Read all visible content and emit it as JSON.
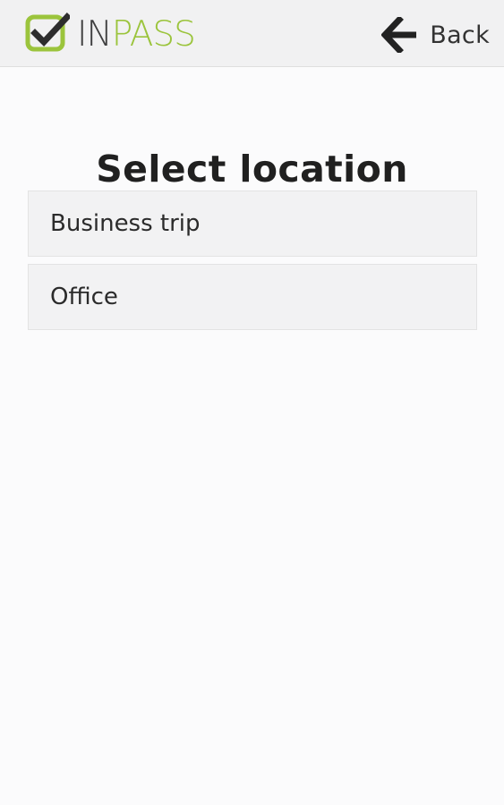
{
  "header": {
    "logo": {
      "prefix": "IN",
      "suffix": "PASS",
      "mark_icon": "checkbox-check-icon"
    },
    "back": {
      "label": "Back",
      "icon": "arrow-left-icon"
    }
  },
  "main": {
    "title": "Select location",
    "locations": [
      {
        "label": "Business trip"
      },
      {
        "label": "Office"
      }
    ]
  },
  "colors": {
    "brand_green": "#9bc43c",
    "logo_gray": "#3f3f40",
    "header_background": "#f1f1f2",
    "item_background": "#f2f2f3",
    "page_background": "#fbfbfc"
  }
}
